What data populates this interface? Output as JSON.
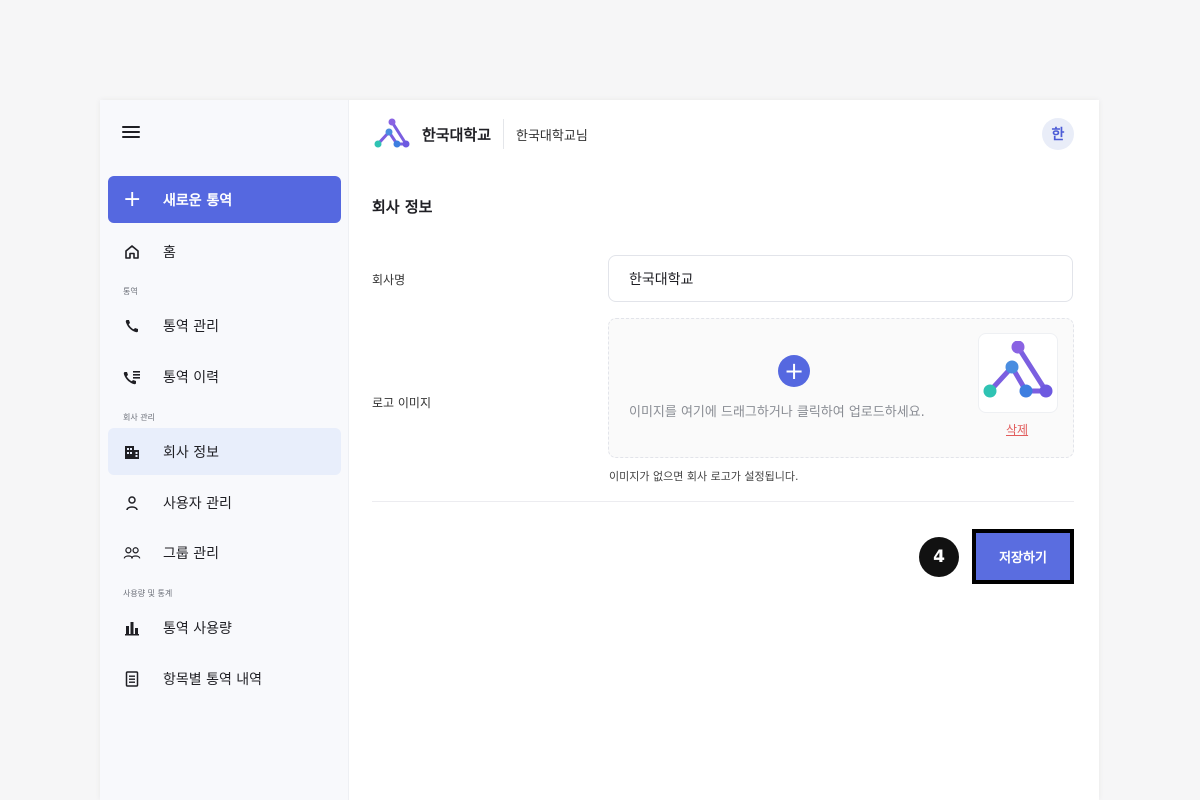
{
  "sidebar": {
    "new_call_label": "새로운 통역",
    "home_label": "홈",
    "section_call": "통역",
    "call_manage_label": "통역 관리",
    "call_history_label": "통역 이력",
    "section_company": "회사 관리",
    "company_info_label": "회사 정보",
    "user_manage_label": "사용자 관리",
    "group_manage_label": "그룹 관리",
    "section_stats": "사용량 및 통계",
    "usage_label": "통역 사용량",
    "item_history_label": "항목별 통역 내역"
  },
  "header": {
    "brand_name": "한국대학교",
    "user_name": "한국대학교님",
    "avatar_initial": "한"
  },
  "form": {
    "title": "회사 정보",
    "company_name_label": "회사명",
    "company_name_value": "한국대학교",
    "logo_label": "로고 이미지",
    "upload_text": "이미지를 여기에 드래그하거나 클릭하여 업로드하세요.",
    "delete_label": "삭제",
    "hint": "이미지가 없으면 회사 로고가 설정됩니다.",
    "step_badge": "4",
    "save_label": "저장하기"
  },
  "colors": {
    "primary": "#5568e0",
    "active_bg": "#e8eefb",
    "delete": "#e25c5c"
  }
}
